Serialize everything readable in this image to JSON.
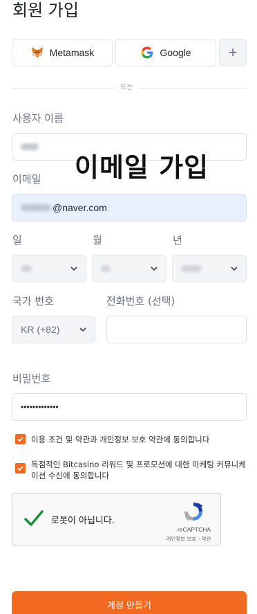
{
  "page": {
    "title": "회원 가입",
    "overlay_caption": "이메일 가입"
  },
  "social": {
    "metamask_label": "Metamask",
    "google_label": "Google",
    "more_label": "+"
  },
  "divider_label": "또는",
  "form": {
    "username": {
      "label": "사용자 이름",
      "value": ""
    },
    "email": {
      "label": "이메일",
      "value_visible": "@naver.com"
    },
    "birth": {
      "day_label": "일",
      "month_label": "월",
      "year_label": "년"
    },
    "country": {
      "label": "국가 번호",
      "value": "KR (+82)"
    },
    "phone": {
      "label": "전화번호 (선택)",
      "value": ""
    },
    "password": {
      "label": "비밀번호",
      "value": "•••••••••••••"
    }
  },
  "consents": [
    {
      "text": "이용 조건 및 약관과 개인정보 보호 약관에 동의합니다",
      "checked": true
    },
    {
      "text": "독점적인 Bitcasino 리워드 및 프로모션에 대한 마케팅 커뮤니케이션 수신에 동의합니다",
      "checked": true
    }
  ],
  "recaptcha": {
    "label": "로봇이 아닙니다.",
    "brand": "reCAPTCHA",
    "terms": "개인정보 보호 - 약관",
    "checked": true
  },
  "submit_label": "계정 만들기",
  "colors": {
    "accent": "#f26a21",
    "input_autofill": "#e8f0fe",
    "check_green": "#1e8e3e"
  }
}
